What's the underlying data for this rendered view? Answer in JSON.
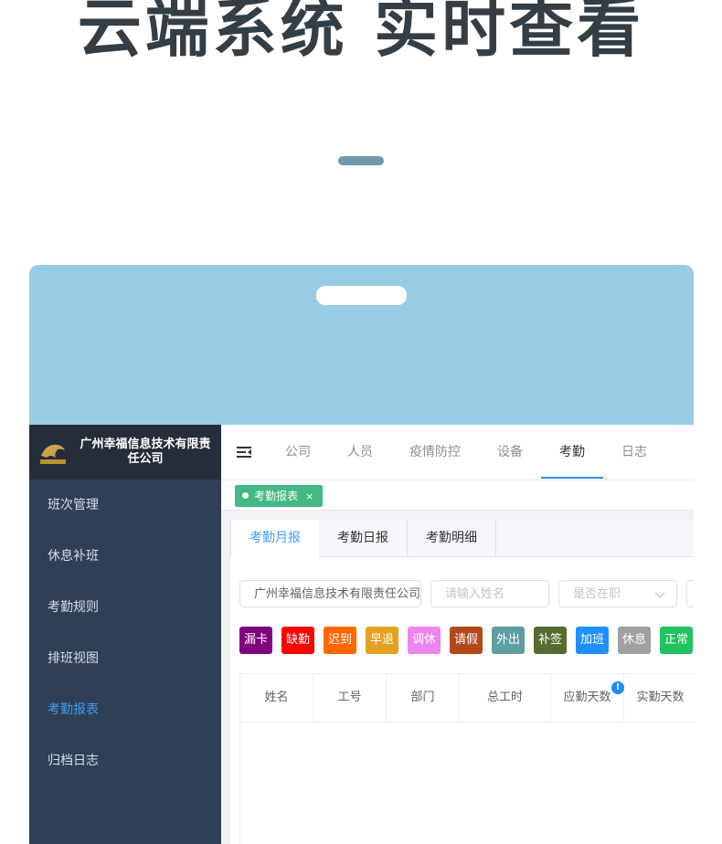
{
  "hero": {
    "title": "云端系统 实时查看"
  },
  "sidebar": {
    "company_name": "广州幸福信息技术有限责任公司",
    "items": [
      {
        "label": "班次管理",
        "active": false
      },
      {
        "label": "休息补班",
        "active": false
      },
      {
        "label": "考勤规则",
        "active": false
      },
      {
        "label": "排班视图",
        "active": false
      },
      {
        "label": "考勤报表",
        "active": true
      },
      {
        "label": "归档日志",
        "active": false
      }
    ]
  },
  "topnav": {
    "items": [
      {
        "label": "公司",
        "active": false
      },
      {
        "label": "人员",
        "active": false
      },
      {
        "label": "疫情防控",
        "active": false
      },
      {
        "label": "设备",
        "active": false
      },
      {
        "label": "考勤",
        "active": true
      },
      {
        "label": "日志",
        "active": false
      }
    ]
  },
  "tags": [
    {
      "label": "考勤报表",
      "close": "×"
    }
  ],
  "tabs": [
    {
      "label": "考勤月报",
      "active": true
    },
    {
      "label": "考勤日报",
      "active": false
    },
    {
      "label": "考勤明细",
      "active": false
    }
  ],
  "filters": {
    "company_value": "广州幸福信息技术有限责任公司",
    "name_placeholder": "请输入姓名",
    "employed_placeholder": "是否在职"
  },
  "status_buttons": [
    {
      "label": "漏卡",
      "color": "#800080"
    },
    {
      "label": "缺勤",
      "color": "#ff0000"
    },
    {
      "label": "迟到",
      "color": "#ff6600"
    },
    {
      "label": "早退",
      "color": "#e6a020"
    },
    {
      "label": "调休",
      "color": "#ee82ee"
    },
    {
      "label": "请假",
      "color": "#b5471a"
    },
    {
      "label": "外出",
      "color": "#5f9ea0"
    },
    {
      "label": "补签",
      "color": "#556b2f"
    },
    {
      "label": "加班",
      "color": "#1e90ff"
    },
    {
      "label": "休息",
      "color": "#a0a0a0"
    },
    {
      "label": "正常",
      "color": "#1fc25e"
    }
  ],
  "table": {
    "headers": [
      "姓名",
      "工号",
      "部门",
      "总工时",
      "应勤天数",
      "实勤天数"
    ],
    "header_badge": "!"
  }
}
